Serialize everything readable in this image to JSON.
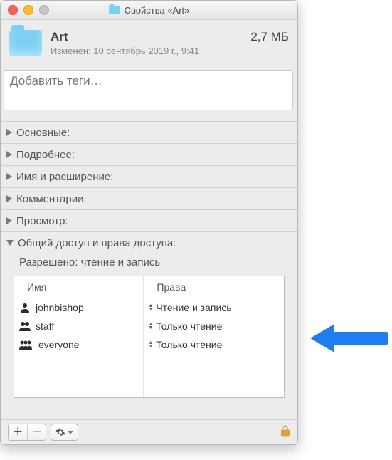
{
  "window": {
    "title": "Свойства «Art»"
  },
  "header": {
    "name": "Art",
    "size": "2,7 МБ",
    "modified": "Изменен: 10 сентябрь 2019 г., 9:41"
  },
  "tags": {
    "placeholder": "Добавить теги…"
  },
  "sections": {
    "general": "Основные:",
    "more": "Подробнее:",
    "name_ext": "Имя и расширение:",
    "comments": "Комментарии:",
    "preview": "Просмотр:",
    "sharing": "Общий доступ и права доступа:"
  },
  "sharing": {
    "summary": "Разрешено: чтение и запись",
    "columns": {
      "name": "Имя",
      "priv": "Права"
    },
    "rows": [
      {
        "icon": "one",
        "name": "johnbishop",
        "perm": "Чтение и запись"
      },
      {
        "icon": "two",
        "name": "staff",
        "perm": "Только чтение"
      },
      {
        "icon": "three",
        "name": "everyone",
        "perm": "Только чтение"
      }
    ]
  },
  "footer": {
    "add": "＋",
    "remove": "－"
  }
}
